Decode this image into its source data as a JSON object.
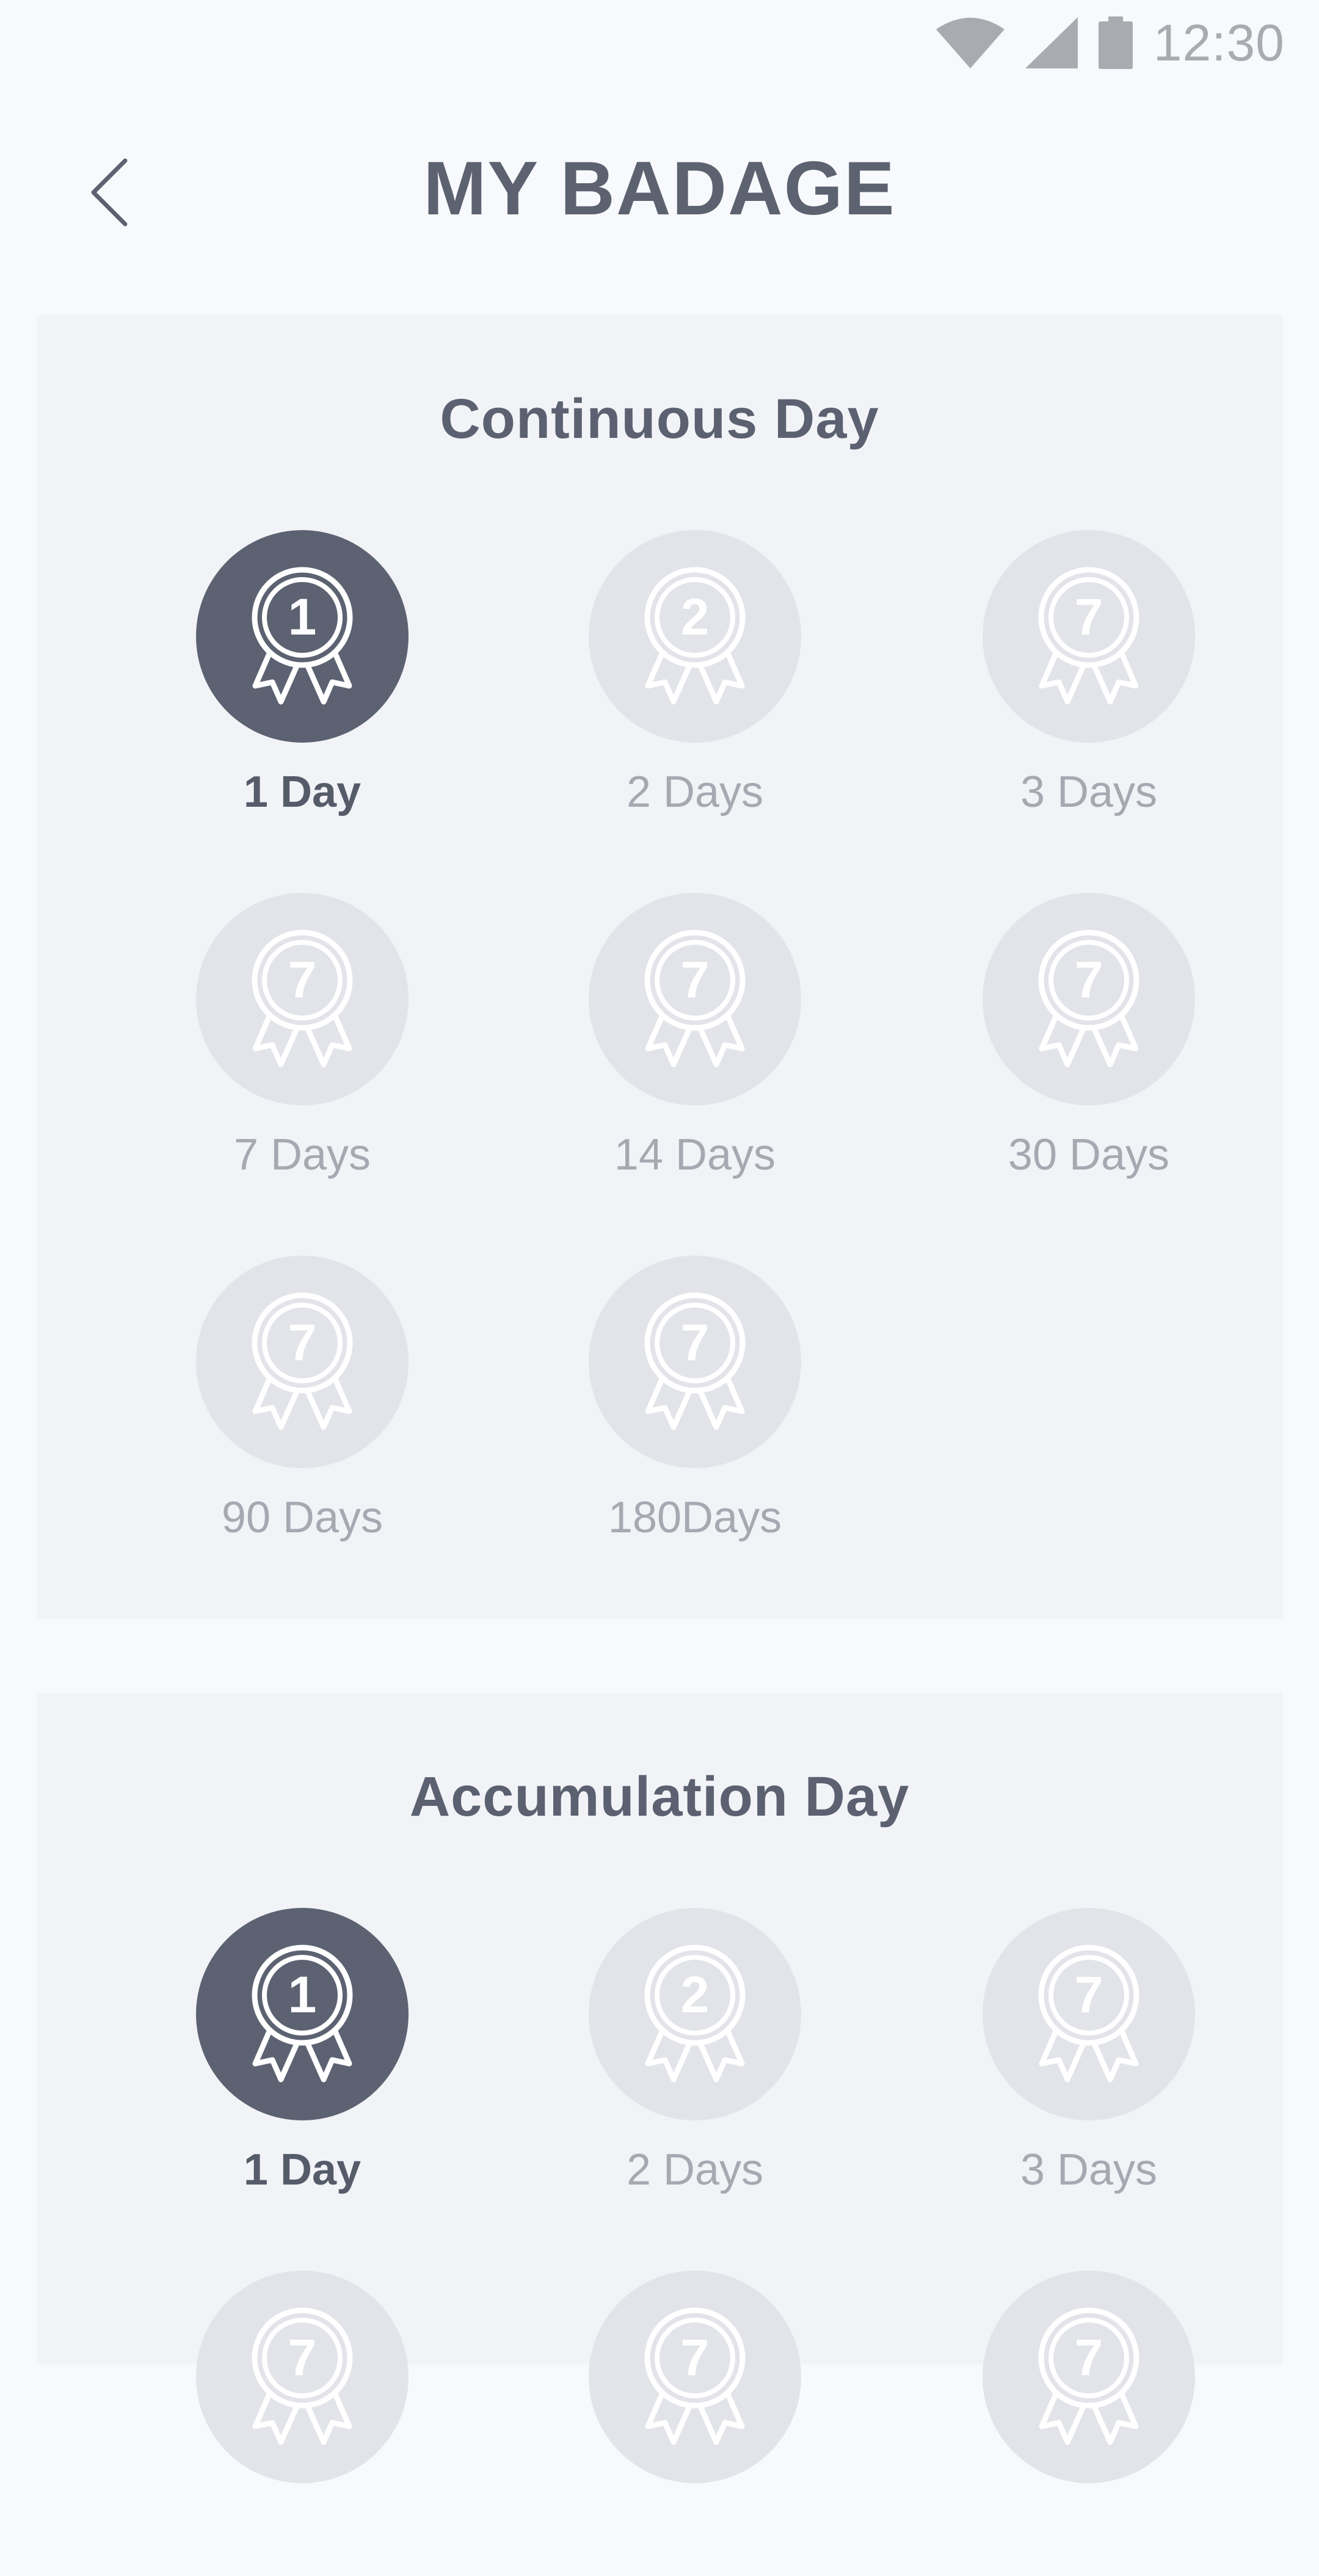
{
  "status_bar": {
    "time": "12:30"
  },
  "header": {
    "title": "MY BADAGE"
  },
  "sections": [
    {
      "title": "Continuous Day",
      "badges": [
        {
          "number": "1",
          "label": "1 Day",
          "earned": true
        },
        {
          "number": "2",
          "label": "2 Days",
          "earned": false
        },
        {
          "number": "7",
          "label": "3 Days",
          "earned": false
        },
        {
          "number": "7",
          "label": "7 Days",
          "earned": false
        },
        {
          "number": "7",
          "label": "14 Days",
          "earned": false
        },
        {
          "number": "7",
          "label": "30 Days",
          "earned": false
        },
        {
          "number": "7",
          "label": "90 Days",
          "earned": false
        },
        {
          "number": "7",
          "label": "180Days",
          "earned": false
        }
      ]
    },
    {
      "title": "Accumulation Day",
      "badges": [
        {
          "number": "1",
          "label": "1 Day",
          "earned": true
        },
        {
          "number": "2",
          "label": "2 Days",
          "earned": false
        },
        {
          "number": "7",
          "label": "3 Days",
          "earned": false
        },
        {
          "number": "7",
          "label": "",
          "earned": false
        },
        {
          "number": "7",
          "label": "",
          "earned": false
        },
        {
          "number": "7",
          "label": "",
          "earned": false
        }
      ]
    }
  ],
  "colors": {
    "earned_bg": "#5c6271",
    "unearned_bg": "#e2e4e9",
    "card_bg": "#f2f3f7",
    "page_bg": "#f8f9fc",
    "title_text": "#5c6270",
    "muted_text": "#a6a9b1"
  },
  "icons": {
    "back": "chevron-left-icon",
    "wifi": "wifi-icon",
    "signal": "cell-signal-icon",
    "battery": "battery-icon",
    "badge": "medal-ribbon-icon"
  }
}
